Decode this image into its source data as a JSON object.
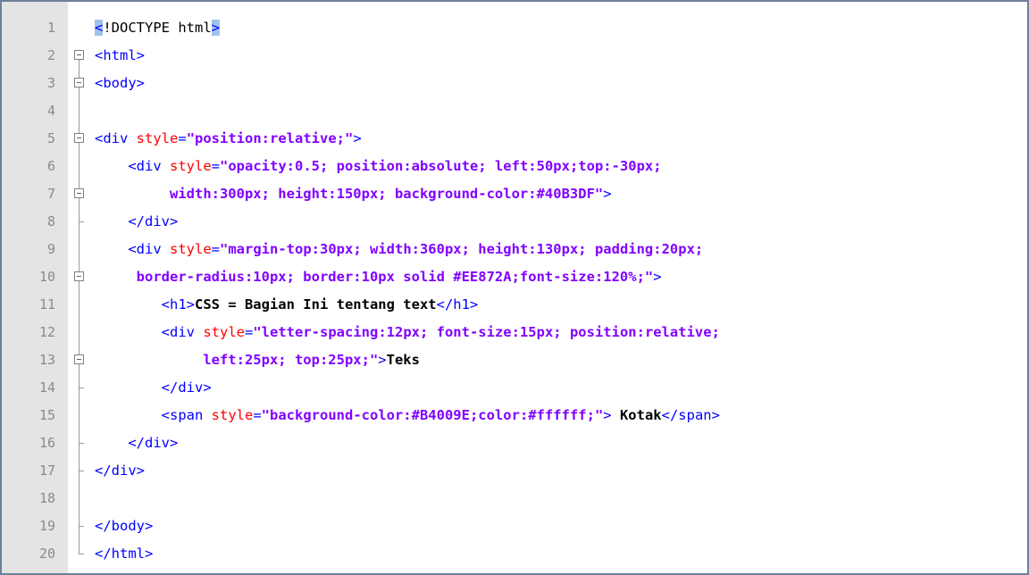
{
  "editor": {
    "lines": [
      {
        "num": "1",
        "segments": [
          {
            "cls": "tag hl",
            "text": "<"
          },
          {
            "cls": "doctype",
            "text": "!DOCTYPE html"
          },
          {
            "cls": "tag hl",
            "text": ">"
          }
        ]
      },
      {
        "num": "2",
        "segments": [
          {
            "cls": "tag",
            "text": "<html>"
          }
        ]
      },
      {
        "num": "3",
        "segments": [
          {
            "cls": "tag",
            "text": "<body>"
          }
        ]
      },
      {
        "num": "4",
        "segments": []
      },
      {
        "num": "5",
        "segments": [
          {
            "cls": "tag",
            "text": "<div "
          },
          {
            "cls": "attr",
            "text": "style"
          },
          {
            "cls": "tag",
            "text": "="
          },
          {
            "cls": "val",
            "text": "\"position:relative;\""
          },
          {
            "cls": "tag",
            "text": ">"
          }
        ]
      },
      {
        "num": "6",
        "segments": [
          {
            "cls": "txt",
            "text": "    "
          },
          {
            "cls": "tag",
            "text": "<div "
          },
          {
            "cls": "attr",
            "text": "style"
          },
          {
            "cls": "tag",
            "text": "="
          },
          {
            "cls": "val",
            "text": "\"opacity:0.5; position:absolute; left:50px;top:-30px;"
          }
        ]
      },
      {
        "num": "7",
        "segments": [
          {
            "cls": "val",
            "text": "         width:300px; height:150px; background-color:#40B3DF\""
          },
          {
            "cls": "tag",
            "text": ">"
          }
        ]
      },
      {
        "num": "8",
        "segments": [
          {
            "cls": "txt",
            "text": "    "
          },
          {
            "cls": "tag",
            "text": "</div>"
          }
        ]
      },
      {
        "num": "9",
        "segments": [
          {
            "cls": "txt",
            "text": "    "
          },
          {
            "cls": "tag",
            "text": "<div "
          },
          {
            "cls": "attr",
            "text": "style"
          },
          {
            "cls": "tag",
            "text": "="
          },
          {
            "cls": "val",
            "text": "\"margin-top:30px; width:360px; height:130px; padding:20px;"
          }
        ]
      },
      {
        "num": "10",
        "segments": [
          {
            "cls": "val",
            "text": "     border-radius:10px; border:10px solid #EE872A;font-size:120%;\""
          },
          {
            "cls": "tag",
            "text": ">"
          }
        ]
      },
      {
        "num": "11",
        "segments": [
          {
            "cls": "txt",
            "text": "        "
          },
          {
            "cls": "tag",
            "text": "<h1>"
          },
          {
            "cls": "txt",
            "text": "CSS = Bagian Ini tentang text"
          },
          {
            "cls": "tag",
            "text": "</h1>"
          }
        ]
      },
      {
        "num": "12",
        "segments": [
          {
            "cls": "txt",
            "text": "        "
          },
          {
            "cls": "tag",
            "text": "<div "
          },
          {
            "cls": "attr",
            "text": "style"
          },
          {
            "cls": "tag",
            "text": "="
          },
          {
            "cls": "val",
            "text": "\"letter-spacing:12px; font-size:15px; position:relative;"
          }
        ]
      },
      {
        "num": "13",
        "segments": [
          {
            "cls": "val",
            "text": "             left:25px; top:25px;\""
          },
          {
            "cls": "tag",
            "text": ">"
          },
          {
            "cls": "txt",
            "text": "Teks"
          }
        ]
      },
      {
        "num": "14",
        "segments": [
          {
            "cls": "txt",
            "text": "        "
          },
          {
            "cls": "tag",
            "text": "</div>"
          }
        ]
      },
      {
        "num": "15",
        "segments": [
          {
            "cls": "txt",
            "text": "        "
          },
          {
            "cls": "tag",
            "text": "<span "
          },
          {
            "cls": "attr",
            "text": "style"
          },
          {
            "cls": "tag",
            "text": "="
          },
          {
            "cls": "val",
            "text": "\"background-color:#B4009E;color:#ffffff;\""
          },
          {
            "cls": "tag",
            "text": ">"
          },
          {
            "cls": "txt",
            "text": " Kotak"
          },
          {
            "cls": "tag",
            "text": "</span>"
          }
        ]
      },
      {
        "num": "16",
        "segments": [
          {
            "cls": "txt",
            "text": "    "
          },
          {
            "cls": "tag",
            "text": "</div>"
          }
        ]
      },
      {
        "num": "17",
        "segments": [
          {
            "cls": "tag",
            "text": "</div>"
          }
        ]
      },
      {
        "num": "18",
        "segments": []
      },
      {
        "num": "19",
        "segments": [
          {
            "cls": "tag",
            "text": "</body>"
          }
        ]
      },
      {
        "num": "20",
        "segments": [
          {
            "cls": "tag",
            "text": "</html>"
          }
        ]
      }
    ],
    "fold_markers": {
      "2": "box",
      "3": "box",
      "5": "box",
      "7": "box",
      "10": "box",
      "13": "box",
      "4": "line",
      "6": "line",
      "8": "end",
      "9": "line",
      "11": "line",
      "12": "line",
      "14": "end",
      "15": "line",
      "16": "end",
      "17": "end",
      "18": "line",
      "19": "end",
      "20": "end-last"
    }
  },
  "colors": {
    "tag": "#0000ff",
    "attribute": "#ff0000",
    "attribute_value": "#8000ff",
    "text": "#000000",
    "gutter": "#e4e4e4",
    "line_number": "#8a8a8a",
    "bracket_highlight": "#9fc3ea"
  }
}
